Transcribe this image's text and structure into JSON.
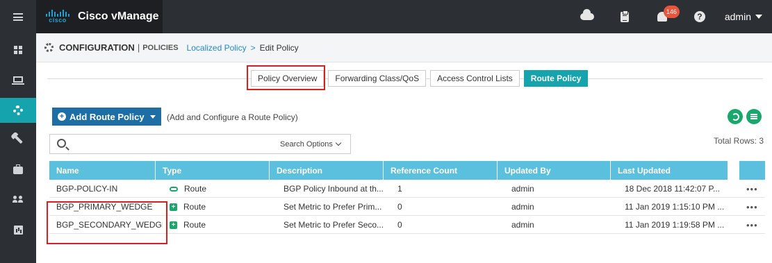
{
  "app": {
    "logo_text": "cisco",
    "title": "Cisco vManage"
  },
  "topbar": {
    "alerts_count": "146",
    "help_glyph": "?",
    "user": "admin"
  },
  "sidebar": {
    "items": [
      {
        "icon": "dashboard-icon"
      },
      {
        "icon": "monitor-icon"
      },
      {
        "icon": "gear-icon",
        "active": true
      },
      {
        "icon": "wrench-icon"
      },
      {
        "icon": "briefcase-icon"
      },
      {
        "icon": "users-icon"
      },
      {
        "icon": "analytics-icon"
      }
    ]
  },
  "header": {
    "title": "CONFIGURATION",
    "separator": "|",
    "subtitle": "POLICIES",
    "breadcrumb_link": "Localized Policy",
    "breadcrumb_arrow": ">",
    "breadcrumb_current": "Edit Policy"
  },
  "tabs": [
    {
      "label": "Policy Overview",
      "active": false
    },
    {
      "label": "Forwarding Class/QoS",
      "active": false
    },
    {
      "label": "Access Control Lists",
      "active": false
    },
    {
      "label": "Route Policy",
      "active": true
    }
  ],
  "toolbar": {
    "add_button": "Add Route Policy",
    "add_plus": "+",
    "add_hint": "(Add and Configure a Route Policy)"
  },
  "search": {
    "value": "",
    "placeholder": "",
    "options_label": "Search Options"
  },
  "total_rows": "Total Rows: 3",
  "table": {
    "columns": [
      "Name",
      "Type",
      "Description",
      "Reference Count",
      "Updated By",
      "Last Updated"
    ],
    "rows": [
      {
        "name": "BGP-POLICY-IN",
        "type": "Route",
        "type_icon": "link-icon",
        "description": "BGP Policy Inbound at th...",
        "reference_count": "1",
        "updated_by": "admin",
        "last_updated": "18 Dec 2018 11:42:07 P...",
        "actions": "•••"
      },
      {
        "name": "BGP_PRIMARY_WEDGE",
        "type": "Route",
        "type_icon": "plus-square-icon",
        "description": "Set Metric to Prefer Prim...",
        "reference_count": "0",
        "updated_by": "admin",
        "last_updated": "11 Jan 2019 1:15:10 PM ...",
        "actions": "•••"
      },
      {
        "name": "BGP_SECONDARY_WEDGE",
        "type": "Route",
        "type_icon": "plus-square-icon",
        "description": "Set Metric to Prefer Seco...",
        "reference_count": "0",
        "updated_by": "admin",
        "last_updated": "11 Jan 2019 1:19:58 PM ...",
        "actions": "•••"
      }
    ]
  },
  "colors": {
    "topbar": "#2c2f33",
    "accent_teal": "#15a3ad",
    "primary_blue": "#1c6ea4",
    "table_header": "#5bc0de",
    "green": "#19a86b",
    "badge_red": "#e8553d",
    "annotation_red": "#d9201e"
  }
}
